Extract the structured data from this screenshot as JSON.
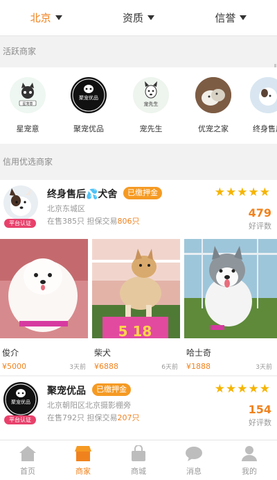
{
  "filters": [
    {
      "label": "北京",
      "active": true
    },
    {
      "label": "资质",
      "active": false
    },
    {
      "label": "信誉",
      "active": false
    }
  ],
  "active_section": {
    "title": "活跃商家",
    "merchants": [
      {
        "name": "星宠意",
        "logo_text": "星宠意"
      },
      {
        "name": "聚宠优品",
        "logo_text": "聚宠优品"
      },
      {
        "name": "宠先生",
        "logo_text": "宠先生"
      },
      {
        "name": "优宠之家",
        "logo_text": ""
      },
      {
        "name": "终身售后",
        "logo_text": ""
      }
    ]
  },
  "credit_section": {
    "title": "信用优选商家"
  },
  "shops": [
    {
      "name": "终身售后💦犬舍",
      "deposit": "已缴押金",
      "location": "北京东城区",
      "stat_prefix": "在售385只  担保交易",
      "stat_trades": "806只",
      "score": "479",
      "score_label": "好评数",
      "cert": "平台认证",
      "pets": [
        {
          "name": "俊介",
          "price": "¥5000",
          "time": "3天前"
        },
        {
          "name": "柴犬",
          "price": "¥6888",
          "time": "6天前"
        },
        {
          "name": "哈士奇",
          "price": "¥1888",
          "time": "3天前"
        }
      ]
    },
    {
      "name": "聚宠优品",
      "deposit": "已缴押金",
      "location": "北京朝阳区北京摄影棚旁",
      "stat_prefix": "在售792只  担保交易",
      "stat_trades": "207只",
      "score": "154",
      "score_label": "好评数",
      "cert": "平台认证",
      "logo_text": "聚宠优品"
    }
  ],
  "nav": [
    {
      "label": "首页",
      "icon": "home-icon"
    },
    {
      "label": "商家",
      "icon": "shop-icon",
      "active": true
    },
    {
      "label": "商城",
      "icon": "mall-icon"
    },
    {
      "label": "消息",
      "icon": "message-icon"
    },
    {
      "label": "我的",
      "icon": "profile-icon"
    }
  ],
  "colors": {
    "accent": "#f0821e",
    "star": "#f5b400",
    "cert": "#e8416b",
    "deposit": "#f59a23"
  }
}
